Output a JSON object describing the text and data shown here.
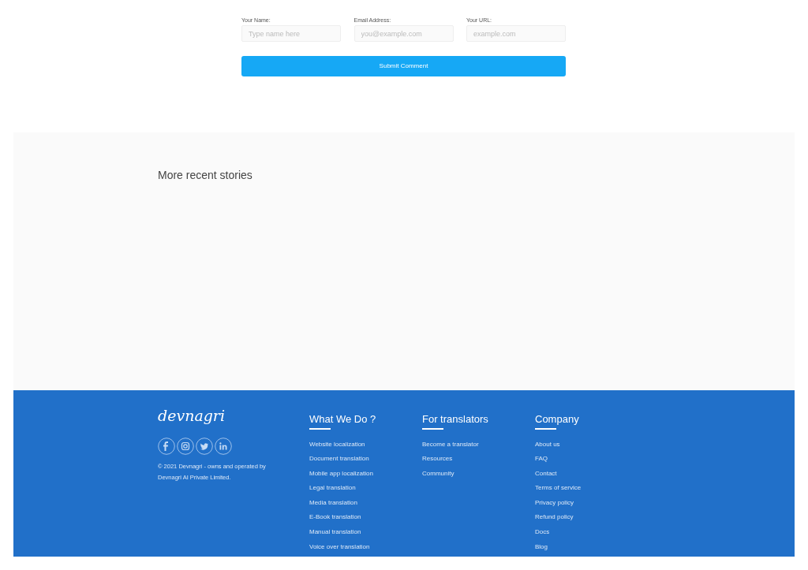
{
  "comment_form": {
    "fields": [
      {
        "label": "Your Name:",
        "placeholder": "Type name here"
      },
      {
        "label": "Email Address:",
        "placeholder": "you@example.com"
      },
      {
        "label": "Your URL:",
        "placeholder": "example.com"
      }
    ],
    "submit": "Submit Comment"
  },
  "recent": {
    "title": "More recent stories"
  },
  "footer": {
    "logo": "devnagri",
    "social": [
      {
        "kind": "facebook"
      },
      {
        "kind": "instagram"
      },
      {
        "kind": "twitter"
      },
      {
        "kind": "linkedin"
      }
    ],
    "copyright": [
      "© 2021 Devnagri - owns and operated by",
      "Devnagri AI Private Limited."
    ],
    "columns": [
      {
        "title": "What We Do ?",
        "links": [
          "Website localization",
          "Document translation",
          "Mobile app localization",
          "Legal translation",
          "Media translation",
          "E-Book translation",
          "Manual translation",
          "Voice over translation"
        ]
      },
      {
        "title": "For translators",
        "links": [
          "Become a translator",
          "Resources",
          "Community"
        ]
      },
      {
        "title": "Company",
        "links": [
          "About us",
          "FAQ",
          "Contact",
          "Terms of service",
          "Privacy policy",
          "Refund policy",
          "Docs",
          "Blog"
        ]
      }
    ]
  }
}
